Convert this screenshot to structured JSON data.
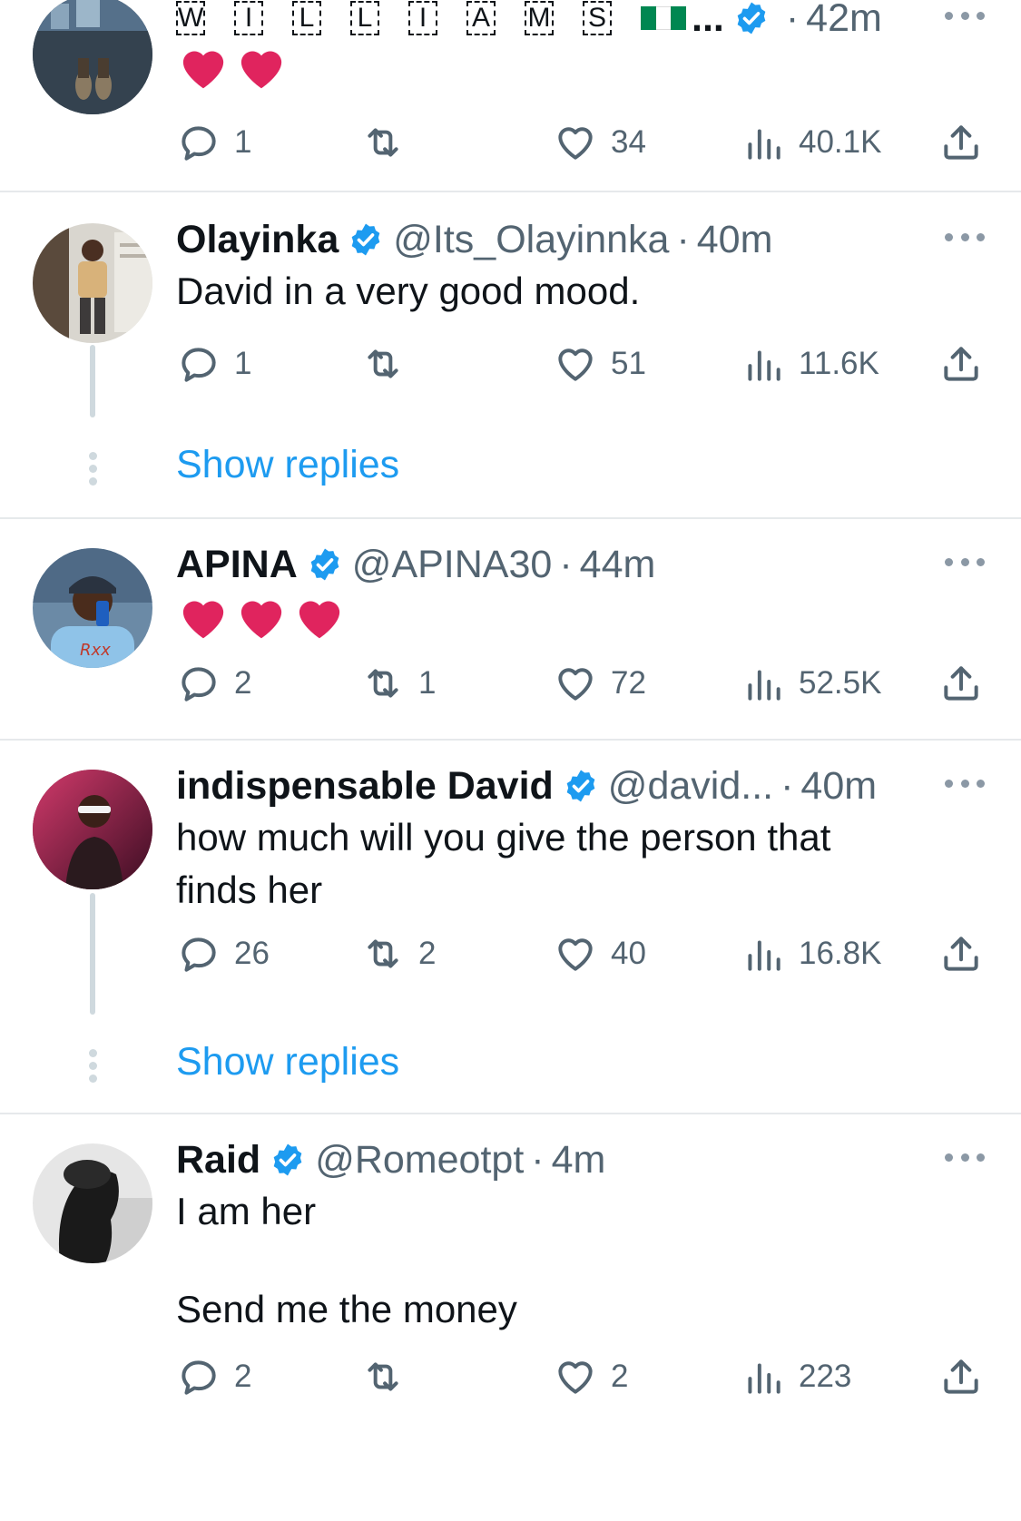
{
  "colors": {
    "accent": "#1d9bf0",
    "text": "#0f1419",
    "muted": "#536471",
    "heart": "#e0245e",
    "verified": "#1d9bf0"
  },
  "tweets": [
    {
      "name_letters": [
        "W",
        "I",
        "L",
        "L",
        "I",
        "A",
        "M",
        "S"
      ],
      "name_suffix": "...",
      "handle": "",
      "dot": "·",
      "time": "42m",
      "hearts": 2,
      "replies": "1",
      "retweets": "",
      "likes": "34",
      "views": "40.1K"
    },
    {
      "name": "Olayinka",
      "handle": "@Its_Olayinnka",
      "dot": "·",
      "time": "40m",
      "text": "David in a very good mood.",
      "replies": "1",
      "retweets": "",
      "likes": "51",
      "views": "11.6K",
      "show_replies": "Show replies"
    },
    {
      "name": "APINA",
      "handle": "@APINA30",
      "dot": "·",
      "time": "44m",
      "hearts": 3,
      "replies": "2",
      "retweets": "1",
      "likes": "72",
      "views": "52.5K"
    },
    {
      "name": "indispensable David",
      "handle": "@david...",
      "dot": "·",
      "time": "40m",
      "text_lines": [
        "how much will you give the person that",
        "finds her"
      ],
      "replies": "26",
      "retweets": "2",
      "likes": "40",
      "views": "16.8K",
      "show_replies": "Show replies"
    },
    {
      "name": "Raid",
      "handle": "@Romeotpt",
      "dot": "·",
      "time": "4m",
      "text_lines": [
        "I am her",
        "Send me the money"
      ],
      "replies": "2",
      "retweets": "",
      "likes": "2",
      "views": "223"
    }
  ]
}
